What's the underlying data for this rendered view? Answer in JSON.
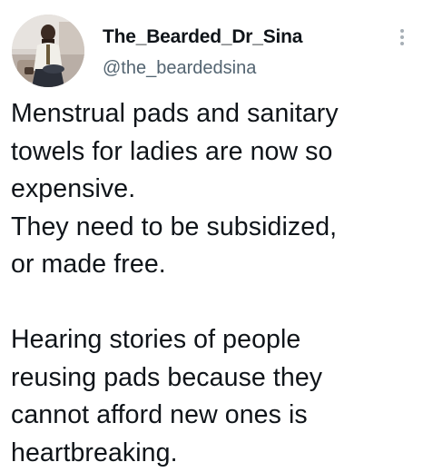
{
  "author": {
    "display_name": "The_Bearded_Dr_Sina",
    "handle": "@the_beardedsina",
    "avatar_icon": "profile-photo"
  },
  "menu": {
    "icon": "more-vertical-icon"
  },
  "tweet": {
    "lines": [
      "Menstrual pads and sanitary",
      "towels for ladies are now so",
      "expensive.",
      "They need to be subsidized,",
      "or made free.",
      "",
      "Hearing stories of people",
      "reusing pads because they",
      "cannot afford new ones is",
      "heartbreaking."
    ]
  },
  "colors": {
    "text": "#0f1419",
    "secondary_text": "#536471",
    "menu_dots": "#a7afb6",
    "background": "#ffffff"
  }
}
